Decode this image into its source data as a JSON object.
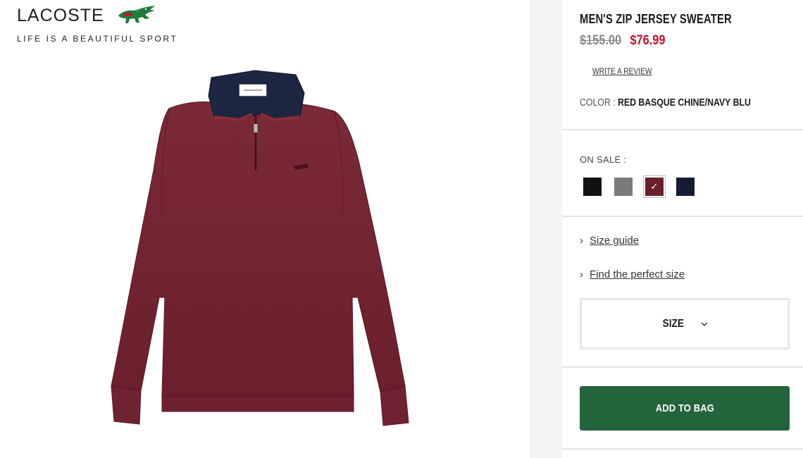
{
  "brand": {
    "name": "LACOSTE",
    "tagline": "LIFE IS A BEAUTIFUL SPORT",
    "logo_icon": "crocodile-icon"
  },
  "product": {
    "title": "MEN'S ZIP JERSEY SWEATER",
    "price_original": "$155.00",
    "price_sale": "$76.99",
    "review_link": "WRITE A REVIEW",
    "color_label": "COLOR :",
    "color_value": "RED BASQUE CHINE/NAVY BLU",
    "image_icon": "sweater-product-image"
  },
  "swatches": {
    "heading": "ON SALE :",
    "items": [
      {
        "name": "black",
        "color": "#111111",
        "selected": false
      },
      {
        "name": "grey",
        "color": "#7a7a7a",
        "selected": false
      },
      {
        "name": "burgundy",
        "color": "#6b1f2a",
        "selected": true
      },
      {
        "name": "navy",
        "color": "#141b33",
        "selected": false
      }
    ]
  },
  "links": {
    "size_guide": "Size guide",
    "find_size": "Find the perfect size",
    "chevron_icon": "chevron-right-icon"
  },
  "size_select": {
    "label": "SIZE",
    "icon": "chevron-down-icon"
  },
  "cart": {
    "add_label": "ADD TO BAG",
    "button_color": "#24643a"
  },
  "colors": {
    "sale_red": "#c8102e",
    "brand_green": "#24643a"
  }
}
